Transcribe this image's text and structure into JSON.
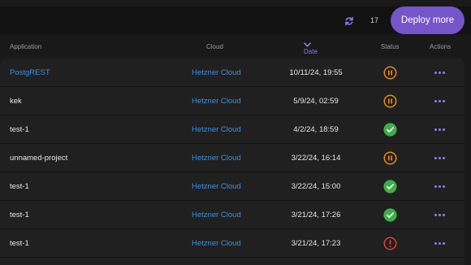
{
  "toolbar": {
    "refresh_icon": "refresh-icon",
    "count": "17",
    "deploy_label": "Deploy more",
    "accent": "#7654c9"
  },
  "table": {
    "columns": {
      "application": "Application",
      "cloud": "Cloud",
      "date": "Date",
      "status": "Status",
      "actions": "Actions"
    },
    "sort_icon": "chevron-down-icon",
    "rows": [
      {
        "application": "PostgREST",
        "cloud": "Hetzner Cloud",
        "date": "10/11/24, 19:55",
        "status": "paused"
      },
      {
        "application": "kek",
        "cloud": "Hetzner Cloud",
        "date": "5/9/24, 02:59",
        "status": "paused"
      },
      {
        "application": "test-1",
        "cloud": "Hetzner Cloud",
        "date": "4/2/24, 18:59",
        "status": "success"
      },
      {
        "application": "unnamed-project",
        "cloud": "Hetzner Cloud",
        "date": "3/22/24, 16:14",
        "status": "paused"
      },
      {
        "application": "test-1",
        "cloud": "Hetzner Cloud",
        "date": "3/22/24, 15:00",
        "status": "success"
      },
      {
        "application": "test-1",
        "cloud": "Hetzner Cloud",
        "date": "3/21/24, 17:26",
        "status": "success"
      },
      {
        "application": "test-1",
        "cloud": "Hetzner Cloud",
        "date": "3/21/24, 17:23",
        "status": "error"
      }
    ]
  },
  "colors": {
    "paused": "#e8891a",
    "success": "#3fae4a",
    "error": "#e53b35",
    "link": "#3d8fdf"
  }
}
